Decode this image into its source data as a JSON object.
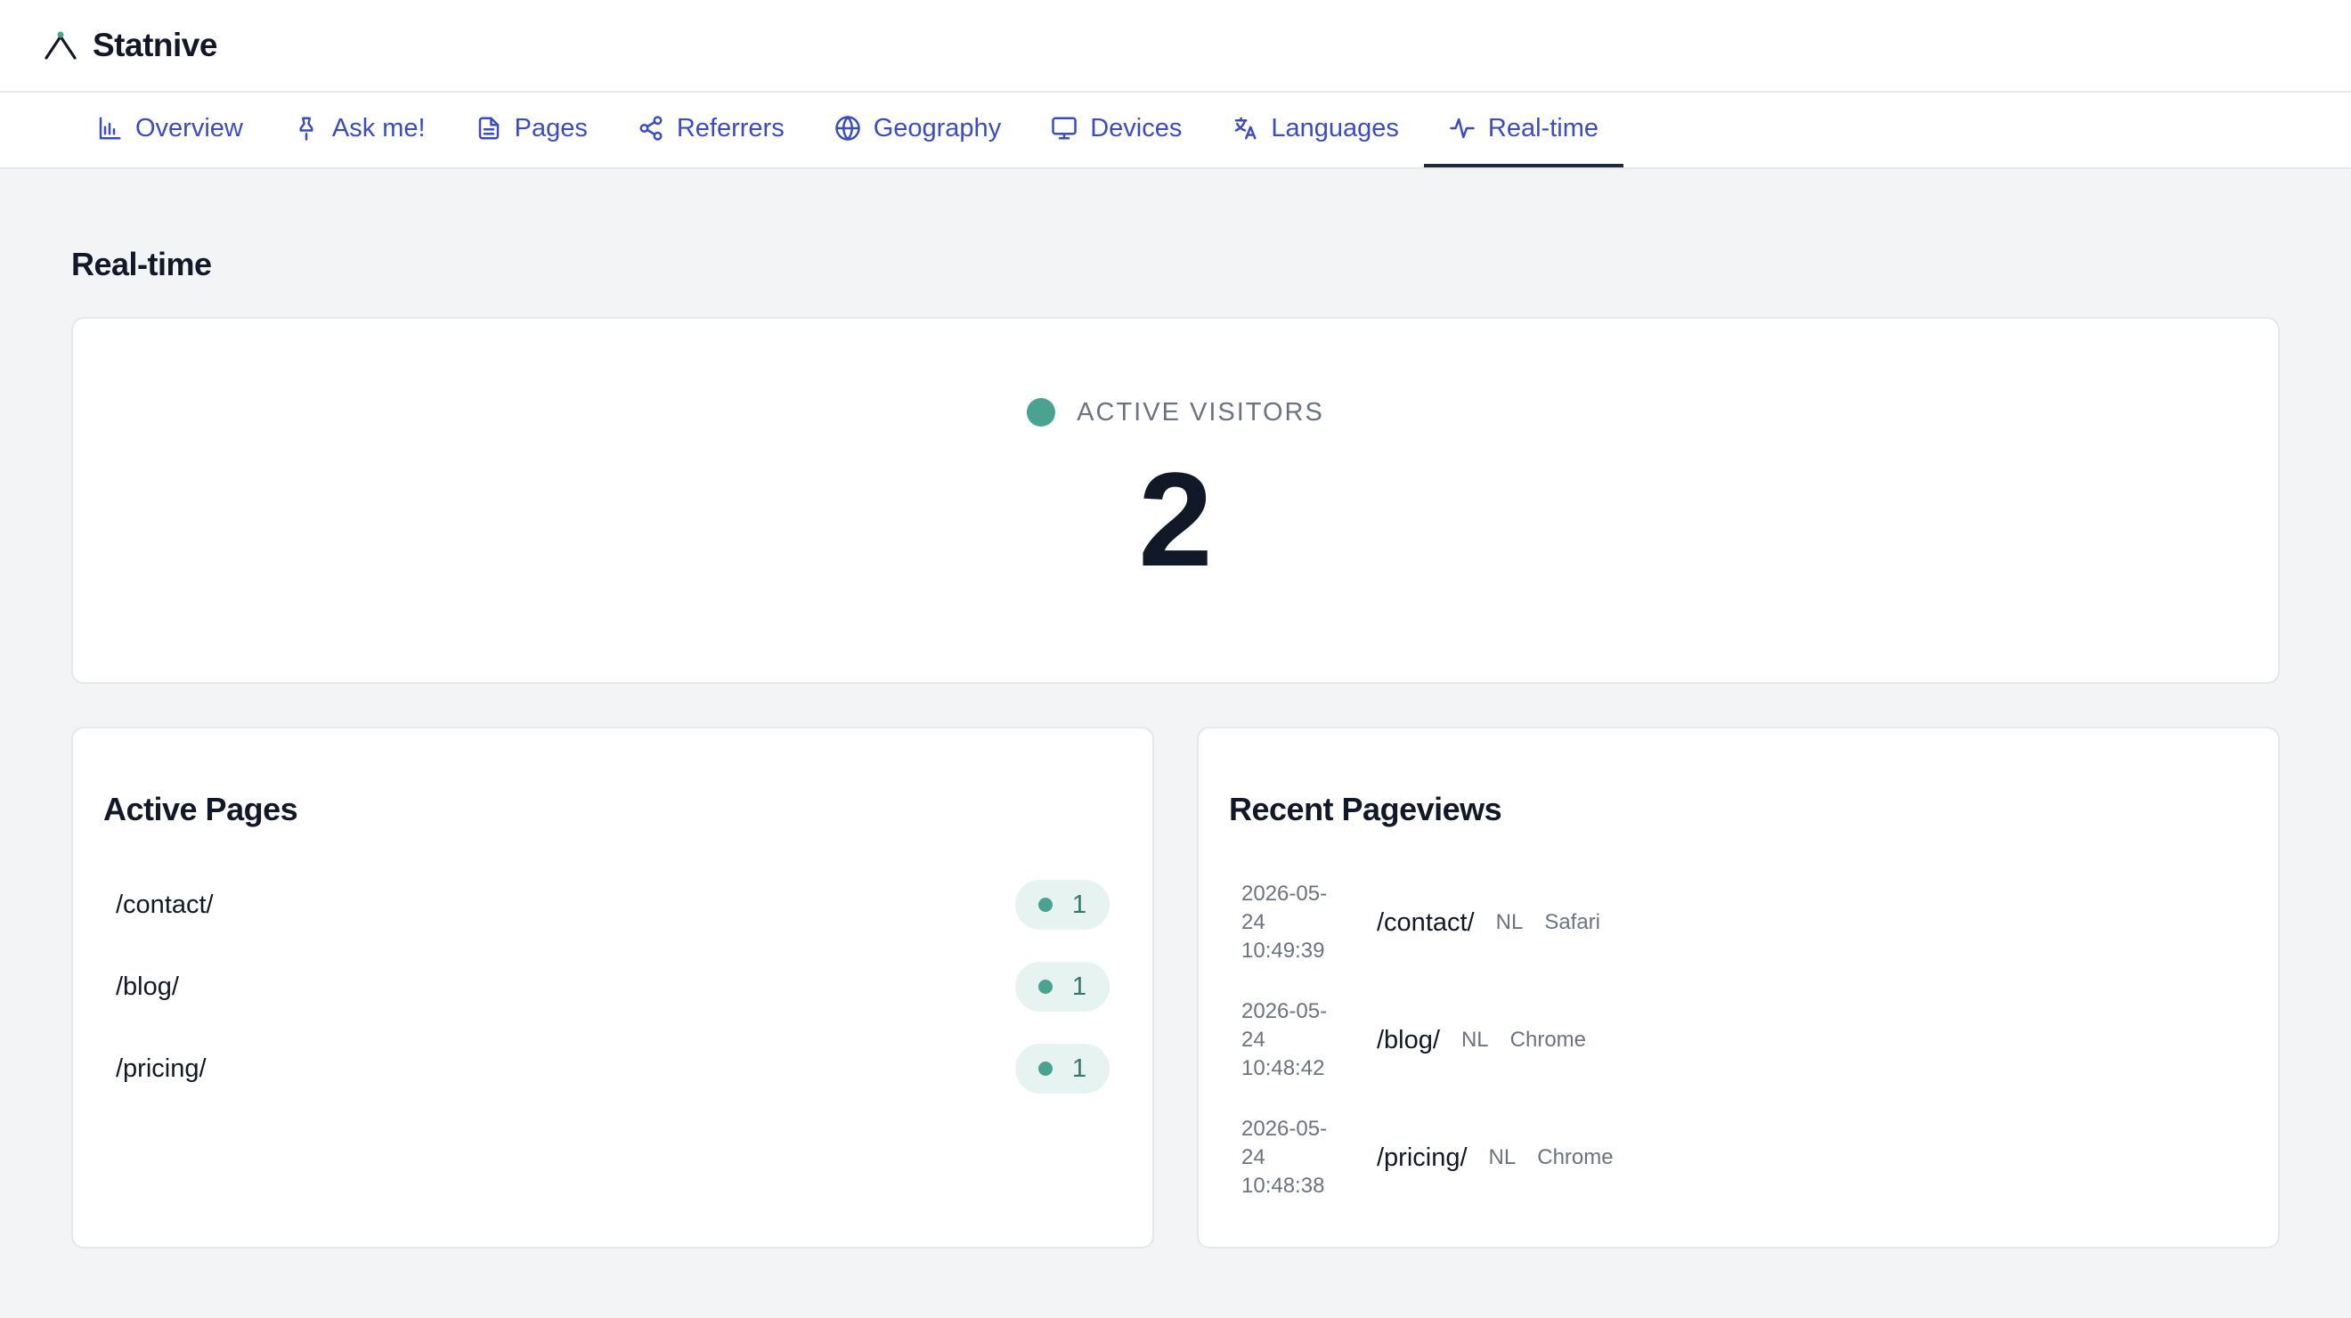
{
  "app": {
    "name": "Statnive",
    "logo_icon": "peak-logo-icon"
  },
  "nav": {
    "tabs": [
      {
        "label": "Overview",
        "icon": "bar-chart-icon",
        "active": false
      },
      {
        "label": "Ask me!",
        "icon": "pin-icon",
        "active": false
      },
      {
        "label": "Pages",
        "icon": "document-icon",
        "active": false
      },
      {
        "label": "Referrers",
        "icon": "share-icon",
        "active": false
      },
      {
        "label": "Geography",
        "icon": "globe-icon",
        "active": false
      },
      {
        "label": "Devices",
        "icon": "monitor-icon",
        "active": false
      },
      {
        "label": "Languages",
        "icon": "translate-icon",
        "active": false
      },
      {
        "label": "Real-time",
        "icon": "activity-icon",
        "active": true
      }
    ]
  },
  "page": {
    "title": "Real-time"
  },
  "active_visitors": {
    "label": "ACTIVE VISITORS",
    "value": "2",
    "dot_color": "#4aa391"
  },
  "active_pages": {
    "title": "Active Pages",
    "items": [
      {
        "path": "/contact/",
        "count": "1"
      },
      {
        "path": "/blog/",
        "count": "1"
      },
      {
        "path": "/pricing/",
        "count": "1"
      }
    ]
  },
  "recent_pageviews": {
    "title": "Recent Pageviews",
    "items": [
      {
        "time": "2026-05-\n24\n10:49:39",
        "path": "/contact/",
        "country": "NL",
        "browser": "Safari"
      },
      {
        "time": "2026-05-\n24\n10:48:42",
        "path": "/blog/",
        "country": "NL",
        "browser": "Chrome"
      },
      {
        "time": "2026-05-\n24\n10:48:38",
        "path": "/pricing/",
        "country": "NL",
        "browser": "Chrome"
      }
    ]
  },
  "colors": {
    "accent": "#3b4cc0",
    "live": "#4aa391",
    "pill_bg": "#e7f3f0"
  }
}
